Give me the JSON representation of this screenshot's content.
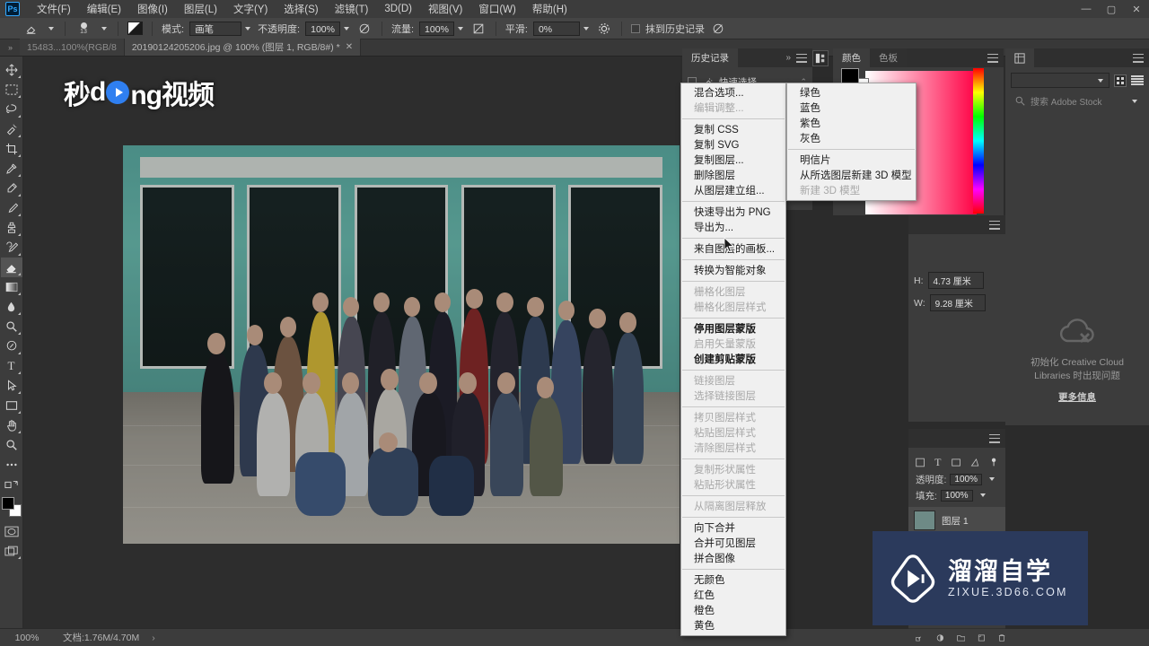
{
  "app": {
    "logo": "Ps",
    "menus": [
      "文件(F)",
      "编辑(E)",
      "图像(I)",
      "图层(L)",
      "文字(Y)",
      "选择(S)",
      "滤镜(T)",
      "3D(D)",
      "视图(V)",
      "窗口(W)",
      "帮助(H)"
    ],
    "window_buttons": [
      "—",
      "▢",
      "✕"
    ]
  },
  "options_bar": {
    "brush_size": "13",
    "mode_label": "模式:",
    "mode_value": "画笔",
    "opacity_label": "不透明度:",
    "opacity_value": "100%",
    "flow_label": "流量:",
    "flow_value": "100%",
    "smoothing_label": "平滑:",
    "smoothing_value": "0%",
    "history_checkbox_label": "抹到历史记录"
  },
  "tabs": {
    "documents": [
      {
        "label": "15483...100%(RGB/8",
        "active": false
      },
      {
        "label": "20190124205206.jpg @ 100% (图层 1, RGB/8#) *",
        "active": true,
        "close": "✕"
      }
    ]
  },
  "toolbar": {
    "tools": [
      {
        "name": "move-tool",
        "glyph": "move"
      },
      {
        "name": "marquee-tool",
        "glyph": "marquee"
      },
      {
        "name": "lasso-tool",
        "glyph": "lasso"
      },
      {
        "name": "quick-selection-tool",
        "glyph": "quickselect"
      },
      {
        "name": "crop-tool",
        "glyph": "crop"
      },
      {
        "name": "eyedropper-tool",
        "glyph": "eyedropper"
      },
      {
        "name": "healing-brush-tool",
        "glyph": "heal"
      },
      {
        "name": "brush-tool",
        "glyph": "brush"
      },
      {
        "name": "clone-stamp-tool",
        "glyph": "stamp"
      },
      {
        "name": "history-brush-tool",
        "glyph": "historybrush"
      },
      {
        "name": "eraser-tool",
        "glyph": "eraser",
        "active": true
      },
      {
        "name": "gradient-tool",
        "glyph": "gradient"
      },
      {
        "name": "blur-tool",
        "glyph": "blur"
      },
      {
        "name": "dodge-tool",
        "glyph": "dodge"
      },
      {
        "name": "pen-tool",
        "glyph": "pen"
      },
      {
        "name": "type-tool",
        "glyph": "T"
      },
      {
        "name": "path-selection-tool",
        "glyph": "arrow"
      },
      {
        "name": "rectangle-tool",
        "glyph": "rect"
      },
      {
        "name": "hand-tool",
        "glyph": "hand"
      },
      {
        "name": "zoom-tool",
        "glyph": "zoom"
      },
      {
        "name": "edit-toolbar-button",
        "glyph": "dots"
      }
    ]
  },
  "context_menu": {
    "items": [
      {
        "label": "混合选项...",
        "disabled": false
      },
      {
        "label": "编辑调整...",
        "disabled": true
      },
      {
        "sep": true
      },
      {
        "label": "复制 CSS",
        "disabled": false
      },
      {
        "label": "复制 SVG",
        "disabled": false
      },
      {
        "label": "复制图层...",
        "disabled": false
      },
      {
        "label": "删除图层",
        "disabled": false
      },
      {
        "label": "从图层建立组...",
        "disabled": false
      },
      {
        "sep": true
      },
      {
        "label": "快速导出为 PNG",
        "disabled": false
      },
      {
        "label": "导出为...",
        "disabled": false
      },
      {
        "sep": true
      },
      {
        "label": "来自图层的画板...",
        "disabled": false
      },
      {
        "sep": true
      },
      {
        "label": "转换为智能对象",
        "disabled": false
      },
      {
        "sep": true
      },
      {
        "label": "栅格化图层",
        "disabled": true
      },
      {
        "label": "栅格化图层样式",
        "disabled": true
      },
      {
        "sep": true
      },
      {
        "label": "停用图层蒙版",
        "disabled": false,
        "bold": true
      },
      {
        "label": "启用矢量蒙版",
        "disabled": true
      },
      {
        "label": "创建剪贴蒙版",
        "disabled": false,
        "bold": true
      },
      {
        "sep": true
      },
      {
        "label": "链接图层",
        "disabled": true
      },
      {
        "label": "选择链接图层",
        "disabled": true
      },
      {
        "sep": true
      },
      {
        "label": "拷贝图层样式",
        "disabled": true
      },
      {
        "label": "粘贴图层样式",
        "disabled": true
      },
      {
        "label": "清除图层样式",
        "disabled": true
      },
      {
        "sep": true
      },
      {
        "label": "复制形状属性",
        "disabled": true
      },
      {
        "label": "粘贴形状属性",
        "disabled": true
      },
      {
        "sep": true
      },
      {
        "label": "从隔离图层释放",
        "disabled": true
      },
      {
        "sep": true
      },
      {
        "label": "向下合并",
        "disabled": false
      },
      {
        "label": "合并可见图层",
        "disabled": false
      },
      {
        "label": "拼合图像",
        "disabled": false
      },
      {
        "sep": true
      },
      {
        "label": "无颜色",
        "disabled": false
      },
      {
        "label": "红色",
        "disabled": false
      },
      {
        "label": "橙色",
        "disabled": false
      },
      {
        "label": "黄色",
        "disabled": false
      }
    ],
    "submenu": [
      {
        "label": "绿色",
        "disabled": false
      },
      {
        "label": "蓝色",
        "disabled": false
      },
      {
        "label": "紫色",
        "disabled": false
      },
      {
        "label": "灰色",
        "disabled": false
      },
      {
        "sep": true
      },
      {
        "label": "明信片",
        "disabled": false
      },
      {
        "label": "从所选图层新建 3D 模型",
        "disabled": false
      },
      {
        "label": "新建 3D 模型",
        "disabled": true
      }
    ]
  },
  "panels": {
    "history": {
      "tab": "历史记录",
      "collapse": "»",
      "entries": [
        {
          "label": "快速选择"
        }
      ]
    },
    "color": {
      "tabs": [
        "颜色",
        "色板"
      ],
      "selected": "颜色"
    },
    "libraries": {
      "search_placeholder": "搜索 Adobe Stock",
      "error_text": "初始化 Creative Cloud Libraries 时出现问题",
      "link_text": "更多信息"
    },
    "properties": {
      "height_label": "H:",
      "height_value": "4.73 厘米",
      "width_label": "W:",
      "width_value": "9.28 厘米"
    },
    "layers": {
      "opacity_label": "透明度:",
      "opacity_value": "100%",
      "fill_label": "填充:",
      "fill_value": "100%",
      "layer_name": "图层 1"
    }
  },
  "status_bar": {
    "zoom": "100%",
    "doc_label": "文档:1.76M/4.70M",
    "arrow": "›"
  },
  "watermarks": {
    "top_left": {
      "prefix": "秒",
      "mid": "d",
      "suffix": "ng视频"
    },
    "bottom_right": {
      "cn": "溜溜自学",
      "en": "ZIXUE.3D66.COM"
    }
  }
}
